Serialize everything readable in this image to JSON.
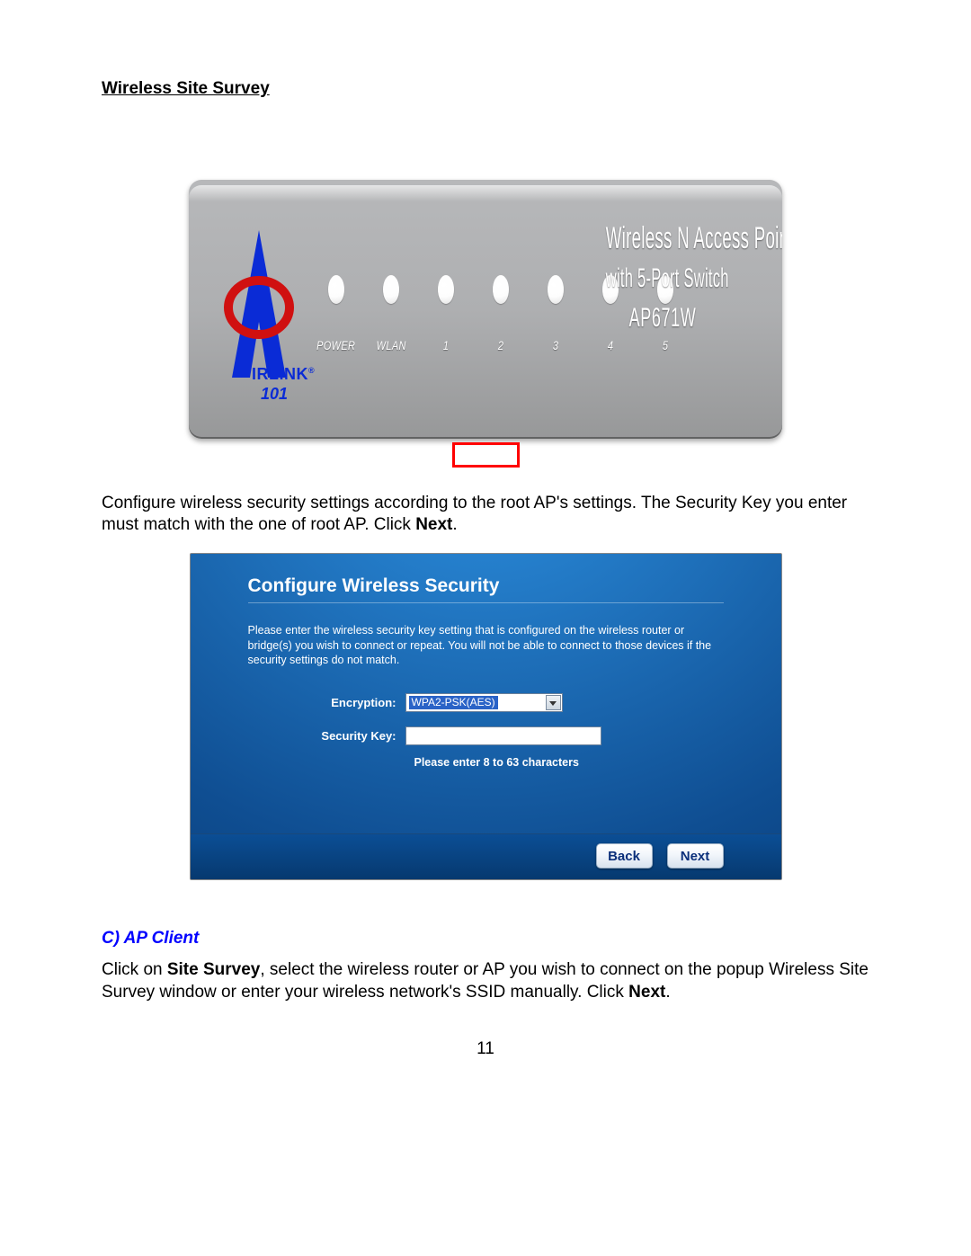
{
  "heading": "Wireless Site Survey",
  "device": {
    "brand_top": "IRLINK",
    "brand_tm": "®",
    "brand_sub": "101",
    "leds": [
      {
        "label": "POWER"
      },
      {
        "label": "WLAN"
      },
      {
        "label": "1"
      },
      {
        "label": "2"
      },
      {
        "label": "3"
      },
      {
        "label": "4"
      },
      {
        "label": "5"
      }
    ],
    "product_line1": "Wireless N Access Point",
    "product_line2": "with 5-Port Switch",
    "product_model": "AP671W"
  },
  "para1_pre": "Configure wireless security settings according to the root AP's settings. The Security Key you enter must match with the one of root AP. Click ",
  "para1_bold": "Next",
  "para1_post": ".",
  "config": {
    "title": "Configure Wireless Security",
    "desc": "Please enter the wireless security key setting that is configured on the wireless router or bridge(s) you wish to connect or repeat. You will not be able to connect to those devices if the security settings do not match.",
    "encryption_label": "Encryption:",
    "encryption_value": "WPA2-PSK(AES)",
    "security_key_label": "Security Key:",
    "security_key_value": "",
    "hint": "Please enter 8 to 63 characters",
    "back": "Back",
    "next": "Next"
  },
  "section_c": "C) AP Client",
  "para2_a": "Click on ",
  "para2_b": "Site Survey",
  "para2_c": ", select the wireless router or AP you wish to connect on the popup Wireless Site Survey window or enter your wireless network's SSID manually. Click ",
  "para2_d": "Next",
  "para2_e": ".",
  "page_number": "11"
}
